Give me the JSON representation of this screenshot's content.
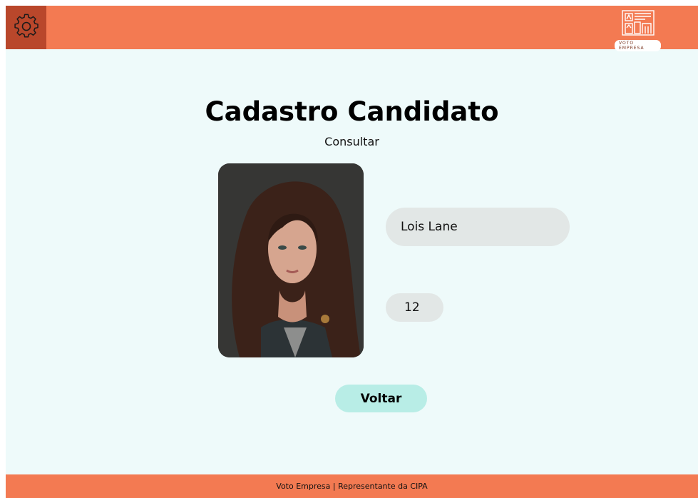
{
  "header": {
    "settings_icon": "gear-icon",
    "logo_icon": "building-ballot-icon",
    "logo_text": "VOTO EMPRESA"
  },
  "main": {
    "title": "Cadastro Candidato",
    "subtitle": "Consultar",
    "candidate": {
      "name": "Lois Lane",
      "number": "12"
    },
    "back_label": "Voltar"
  },
  "footer": {
    "text": "Voto Empresa | Representante da CIPA"
  },
  "colors": {
    "header_bg": "#f37a52",
    "settings_bg": "#b9472b",
    "page_bg": "#eefafa",
    "field_bg": "#e2e7e6",
    "button_bg": "#b8ede6"
  }
}
